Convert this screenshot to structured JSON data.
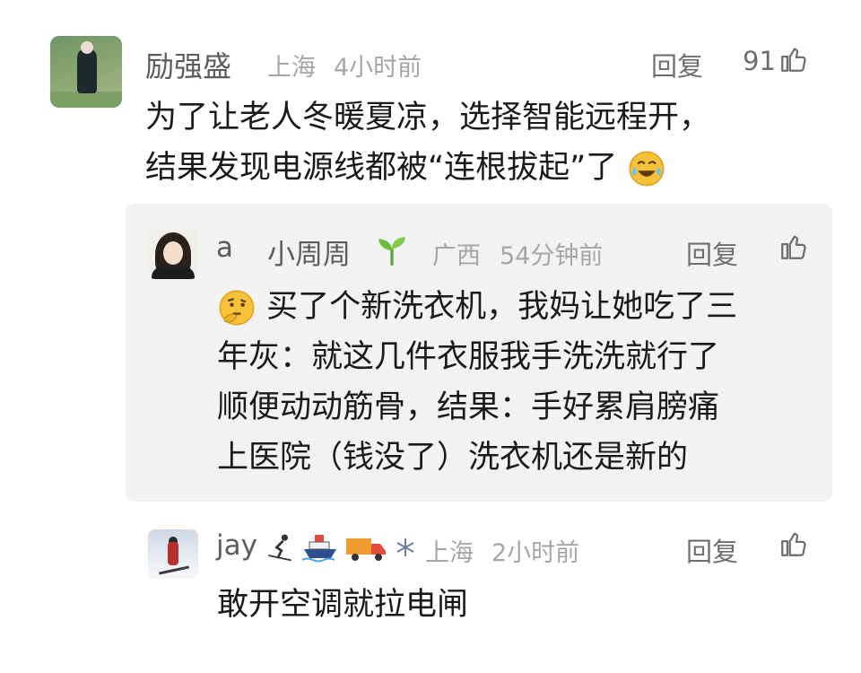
{
  "comment": {
    "user": "励强盛",
    "location": "上海",
    "time": "4小时前",
    "reply_label": "回复",
    "likes": "91",
    "lines": [
      "为了让老人冬暖夏凉，选择智能远程开，",
      "结果发现电源线都被“连根拔起”了"
    ],
    "trailing_emoji": "crying-laughing-emoji"
  },
  "replies": [
    {
      "user": "a",
      "nickname": "小周周",
      "badge_icon": "seedling-icon",
      "location": "广西",
      "time": "54分钟前",
      "reply_label": "回复",
      "leading_emoji": "thinking-face-emoji",
      "lines": [
        "买了个新洗衣机，我妈让她吃了三",
        "年灰：就这几件衣服我手洗洗就行了",
        "顺便动动筋骨，结果：手好累肩膀痛",
        "上医院（钱没了）洗衣机还是新的"
      ]
    },
    {
      "user": "jay",
      "badge_icons": [
        "skier-icon",
        "ship-icon",
        "truck-icon",
        "snowflake-icon"
      ],
      "location": "上海",
      "time": "2小时前",
      "reply_label": "回复",
      "lines": [
        "敢开空调就拉电闸"
      ]
    }
  ]
}
